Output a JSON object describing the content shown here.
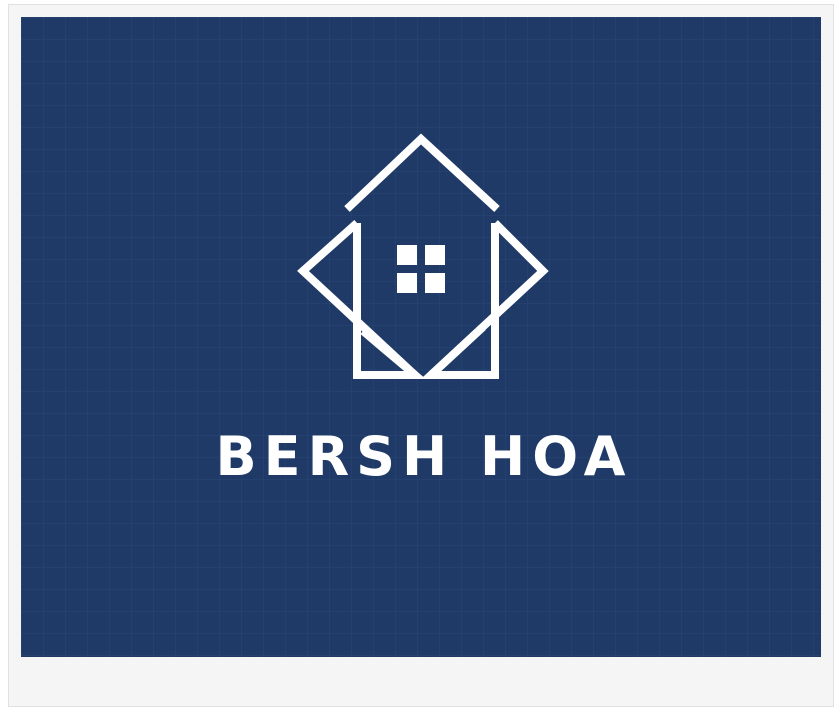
{
  "logo": {
    "brand_name": "BERSH HOA",
    "icon": "house-window-icon",
    "background_color": "#1f3a66",
    "grid_color": "#2a4775",
    "foreground_color": "#ffffff"
  },
  "frame": {
    "background_color": "#f5f5f5",
    "border_color": "#e1e1e1"
  }
}
